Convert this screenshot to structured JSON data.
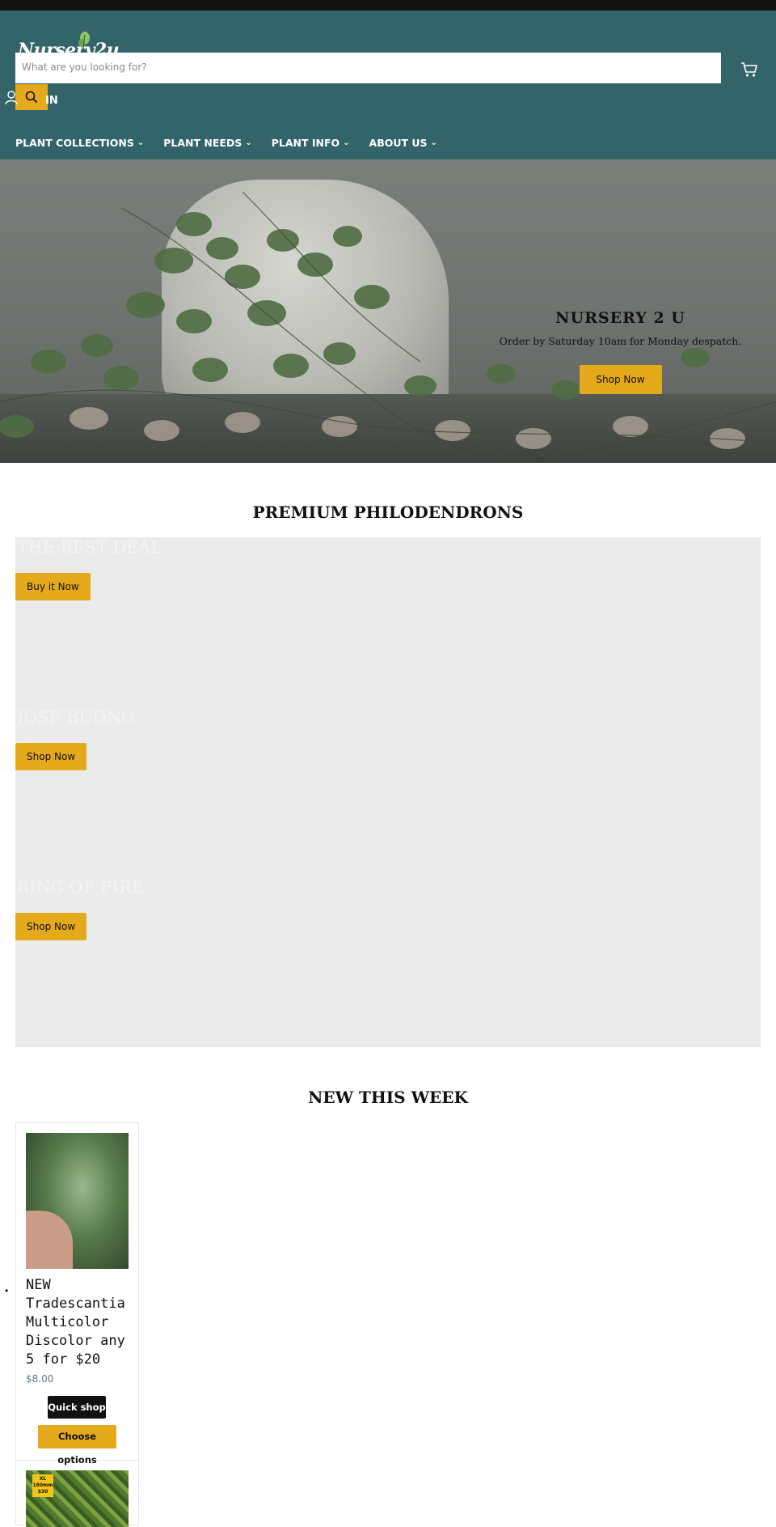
{
  "header": {
    "logo_text": "Nursery2u",
    "search": {
      "placeholder": "What are you looking for?"
    },
    "account_label": "IN",
    "nav": [
      {
        "label": "PLANT COLLECTIONS"
      },
      {
        "label": "PLANT NEEDS"
      },
      {
        "label": "PLANT INFO"
      },
      {
        "label": "ABOUT US"
      }
    ],
    "caret_glyph": "⌄"
  },
  "hero": {
    "title": "NURSERY 2 U",
    "subtitle": "Order by Saturday 10am for Monday despatch.",
    "button": "Shop Now"
  },
  "philodendrons": {
    "title": "PREMIUM PHILODENDRONS",
    "slides": [
      {
        "heading": "THE BEST DEAL",
        "button": "Buy it Now"
      },
      {
        "heading": "JOSE BUONO",
        "button": "Shop Now"
      },
      {
        "heading": "RING OF FIRE",
        "button": "Shop Now"
      }
    ]
  },
  "new_this_week": {
    "title": "NEW THIS WEEK",
    "products": [
      {
        "title": "NEW Tradescantia Multicolor Discolor any 5 for $20",
        "price": "$8.00",
        "quick_shop": "Quick shop",
        "choose_options": "Choose options"
      },
      {
        "badge": [
          "XL",
          "180mm",
          "$30"
        ]
      }
    ]
  },
  "colors": {
    "header_bg": "#336469",
    "accent": "#e5a91c",
    "topbar": "#121212"
  }
}
